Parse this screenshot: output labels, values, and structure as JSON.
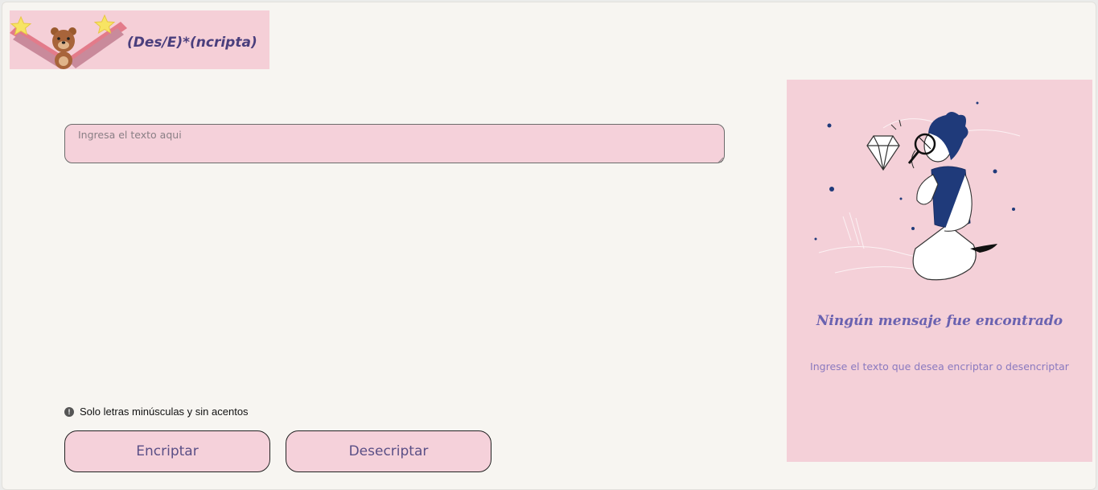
{
  "header": {
    "logo_text": "(Des/E)*(ncripta)",
    "logo_icons": [
      "star-icon",
      "bear-icon",
      "star-icon"
    ]
  },
  "input": {
    "placeholder": "Ingresa el texto aqui",
    "value": ""
  },
  "hint": {
    "icon": "info-icon",
    "icon_glyph": "!",
    "text": "Solo letras minúsculas y sin acentos"
  },
  "actions": {
    "encrypt_label": "Encriptar",
    "decrypt_label": "Desecriptar"
  },
  "output": {
    "illustration": "person-with-magnifier-icon",
    "title": "Ningún mensaje fue encontrado",
    "subtitle": "Ingrese el texto que desea encriptar o desencriptar"
  },
  "colors": {
    "background": "#f7f5f1",
    "panel_pink": "#f4d0d8",
    "button_text": "#5a4f86",
    "title_purple": "#6a62b0",
    "subtitle_purple": "#8a79bf",
    "navy": "#1f3a7a"
  }
}
